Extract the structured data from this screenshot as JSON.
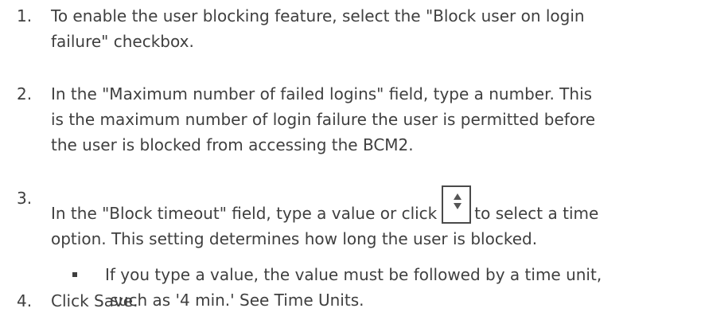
{
  "steps": [
    {
      "number": "1.",
      "lines": [
        "To enable the user blocking feature, select the \"Block user on login",
        "failure\" checkbox."
      ]
    },
    {
      "number": "2.",
      "lines": [
        "In the \"Maximum number of failed logins\" field, type a number. This",
        "is the maximum number of login failure the user is permitted before",
        "the user is blocked from accessing the BCM2."
      ]
    },
    {
      "number": "3.",
      "line1_before": "In the \"Block timeout\" field, type a value or click",
      "line1_after": "to select a time",
      "line2": "option. This setting determines how long the user is blocked.",
      "stepper_icon": "up-down-stepper-icon",
      "sub_bullet": {
        "lines": [
          "If you type a value, the value must be followed by a time unit,",
          " such as '4 min.' See Time Units."
        ]
      }
    },
    {
      "number": "4.",
      "text": "Click Save."
    }
  ]
}
